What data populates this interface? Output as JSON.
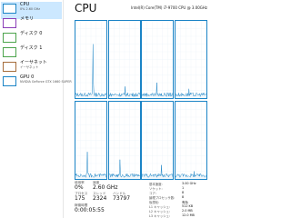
{
  "sidebar": {
    "items": [
      {
        "name": "CPU",
        "sub": "0%  2.60 GHz",
        "sub2": "",
        "color": "#1b84c6",
        "selected": true
      },
      {
        "name": "メモリ",
        "sub": "",
        "sub2": "",
        "color": "#8b3fb8",
        "selected": false
      },
      {
        "name": "ディスク 0",
        "sub": "",
        "sub2": "",
        "color": "#4ca44c",
        "selected": false
      },
      {
        "name": "ディスク 1",
        "sub": "",
        "sub2": "",
        "color": "#4ca44c",
        "selected": false
      },
      {
        "name": "イーサネット",
        "sub": "イーサネット",
        "sub2": "",
        "color": "#a66d3b",
        "selected": false
      },
      {
        "name": "GPU 0",
        "sub": "NVIDIA GeForce GTX 1660 SUPER",
        "sub2": "",
        "color": "#1b84c6",
        "selected": false
      }
    ]
  },
  "header": {
    "title": "CPU",
    "cpu_name": "Intel(R) Core(TM) i7-9700 CPU @ 3.00GHz",
    "graph_caption_left": "",
    "graph_caption_right": ""
  },
  "cores": [
    {
      "spike": 0.7
    },
    {
      "spike": 0.15
    },
    {
      "spike": 0.2
    },
    {
      "spike": 0.12
    },
    {
      "spike": 0.35
    },
    {
      "spike": 0.25
    },
    {
      "spike": 0.18
    },
    {
      "spike": 0.1
    }
  ],
  "stats": {
    "utilization_label": "使用率",
    "utilization_value": "0%",
    "speed_label": "速度",
    "speed_value": "2.60 GHz",
    "processes_label": "プロセス",
    "processes_value": "175",
    "threads_label": "スレッド",
    "threads_value": "2324",
    "handles_label": "ハンドル",
    "handles_value": "73797",
    "uptime_label": "稼働時間",
    "uptime_value": "0:00:05:55"
  },
  "specs": [
    {
      "label": "基本速度:",
      "value": "3.00 GHz"
    },
    {
      "label": "ソケット:",
      "value": "1"
    },
    {
      "label": "コア:",
      "value": "8"
    },
    {
      "label": "論理プロセッサ数:",
      "value": "8"
    },
    {
      "label": "仮想化:",
      "value": "有効"
    },
    {
      "label": "L1 キャッシュ:",
      "value": "512 KB"
    },
    {
      "label": "L2 キャッシュ:",
      "value": "2.0 MB"
    },
    {
      "label": "L3 キャッシュ:",
      "value": "12.0 MB"
    }
  ]
}
